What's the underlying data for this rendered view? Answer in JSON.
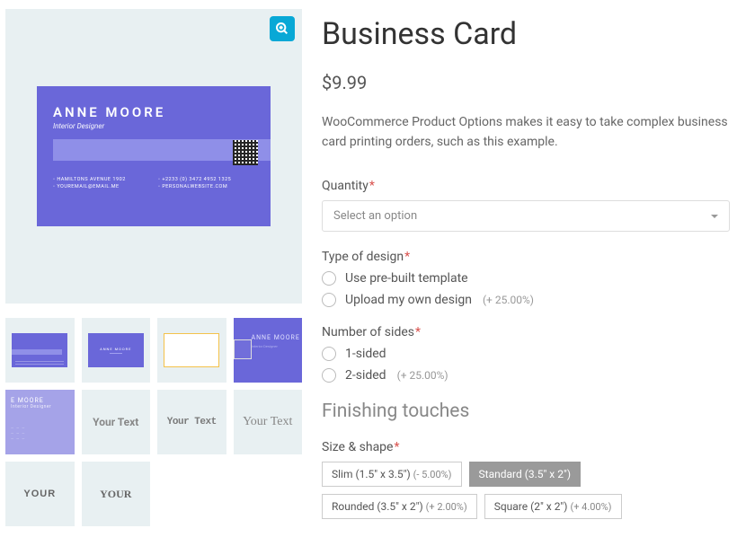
{
  "product": {
    "title": "Business Card",
    "price": "$9.99",
    "description": "WooCommerce Product Options makes it easy to take complex business card printing orders, such as this example."
  },
  "sample_card": {
    "name": "ANNE MOORE",
    "role": "Interior Designer",
    "address": "HAMILTONS AVENUE 1902",
    "phone": "+2233 (0) 3472 4952 1325",
    "email": "YOUREMAIL@EMAIL.ME",
    "website": "PERSONALWEBSITE.COM"
  },
  "thumbs": {
    "back_label": "ANNE MOORE",
    "full_name": "ANNE MOORE",
    "full_role": "Interior Designer",
    "moore_crop": "E MOORE",
    "yt0": "Your Text",
    "yt1": "Your Text",
    "yt2": "Your Text",
    "yt3": "YOUR",
    "yt4": "YOUR"
  },
  "fields": {
    "quantity": {
      "label": "Quantity",
      "placeholder": "Select an option"
    },
    "design": {
      "label": "Type of design",
      "options": [
        {
          "label": "Use pre-built template",
          "mod": ""
        },
        {
          "label": "Upload my own design",
          "mod": "(+ 25.00%)"
        }
      ]
    },
    "sides": {
      "label": "Number of sides",
      "options": [
        {
          "label": "1-sided",
          "mod": ""
        },
        {
          "label": "2-sided",
          "mod": "(+ 25.00%)"
        }
      ]
    }
  },
  "finishing": {
    "heading": "Finishing touches",
    "size": {
      "label": "Size & shape",
      "options": [
        {
          "label": "Slim (1.5\" x 3.5\")",
          "mod": "(- 5.00%)",
          "selected": false
        },
        {
          "label": "Standard (3.5\" x 2\")",
          "mod": "",
          "selected": true
        },
        {
          "label": "Rounded (3.5\" x 2\")",
          "mod": "(+ 2.00%)",
          "selected": false
        },
        {
          "label": "Square (2\" x 2\")",
          "mod": "(+ 4.00%)",
          "selected": false
        }
      ]
    }
  }
}
